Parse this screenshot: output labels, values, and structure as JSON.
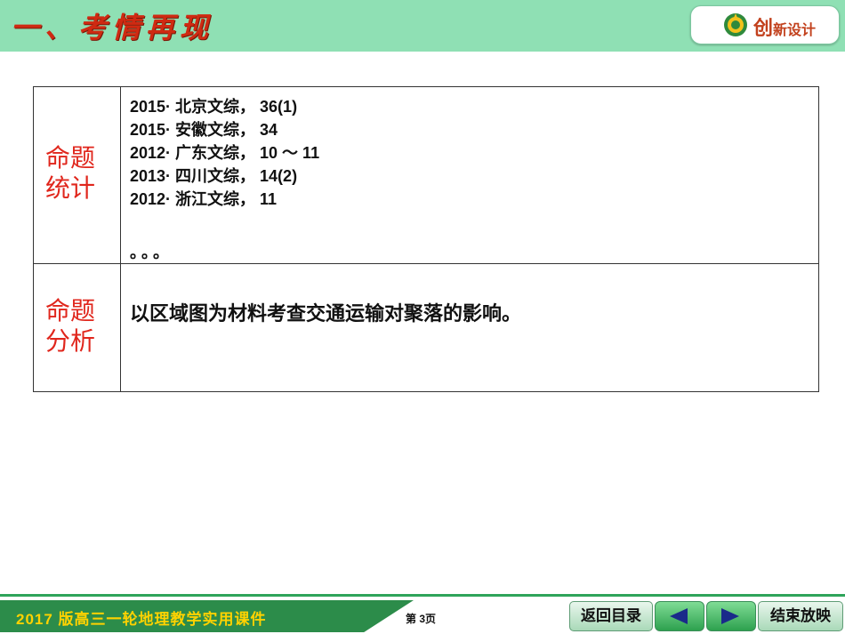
{
  "header": {
    "title": "一、考情再现",
    "brand": {
      "main": "创",
      "rest": "新设计"
    }
  },
  "table": {
    "rows": [
      {
        "label": "命题统计",
        "items": [
          "2015· 北京文综， 36(1)",
          "2015· 安徽文综， 34",
          "2012· 广东文综， 10 ～ 11",
          "2013· 四川文综， 14(2)",
          "2012· 浙江文综， 11"
        ],
        "ellipsis": "。。。"
      },
      {
        "label": "命题分析",
        "text": "以区域图为材料考查交通运输对聚落的影响。"
      }
    ]
  },
  "footer": {
    "course_title": "2017 版高三一轮地理教学实用课件",
    "page": "第 3页",
    "back_button": "返回目录",
    "end_button": "结束放映"
  },
  "colors": {
    "header_bg": "#8fe0b4",
    "title_red": "#cf2a12",
    "label_red": "#e0261c",
    "footer_green": "#2c8c4a",
    "footer_yellow": "#ffd200"
  },
  "icons": [
    "logo-emblem-icon",
    "prev-arrow-icon",
    "next-arrow-icon"
  ]
}
